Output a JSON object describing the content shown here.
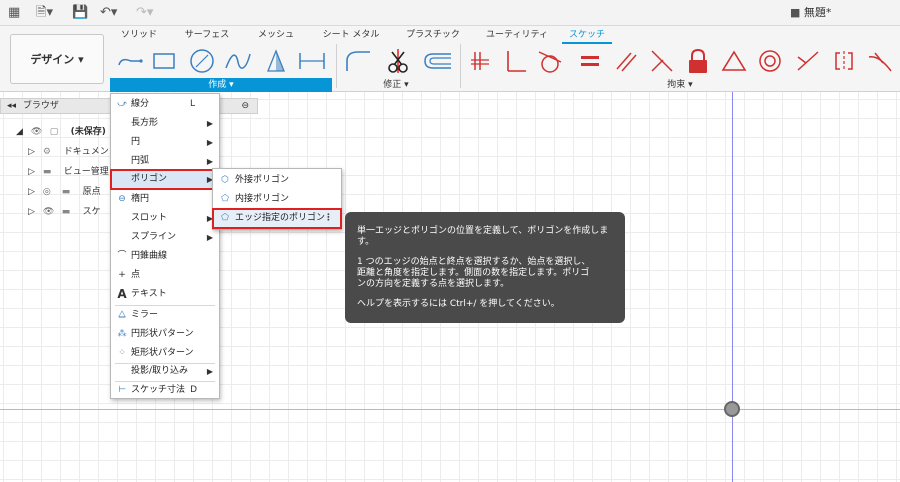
{
  "titlebar": {
    "doc_title": "無題*"
  },
  "ribbon": {
    "design_label": "デザイン ▾",
    "tabs": [
      "ソリッド",
      "サーフェス",
      "メッシュ",
      "シート メタル",
      "プラスチック",
      "ユーティリティ",
      "スケッチ"
    ],
    "active_tab": "スケッチ",
    "group_create": "作成 ▾",
    "group_modify": "修正 ▾",
    "group_constraints": "拘束 ▾"
  },
  "browser": {
    "header": "ブラウザ",
    "items": [
      {
        "label": "(未保存)"
      },
      {
        "label": "ドキュメン"
      },
      {
        "label": "ビュー管理"
      },
      {
        "label": "原点"
      },
      {
        "label": "スケ"
      }
    ]
  },
  "create_menu": {
    "items": [
      {
        "label": "線分",
        "shortcut": "L"
      },
      {
        "label": "長方形"
      },
      {
        "label": "円"
      },
      {
        "label": "円弧"
      },
      {
        "label": "ポリゴン"
      },
      {
        "label": "楕円"
      },
      {
        "label": "スロット"
      },
      {
        "label": "スプライン"
      },
      {
        "label": "円錐曲線"
      },
      {
        "label": "点"
      },
      {
        "label": "テキスト"
      },
      {
        "label": "ミラー"
      },
      {
        "label": "円形状パターン"
      },
      {
        "label": "矩形状パターン"
      },
      {
        "label": "投影/取り込み"
      },
      {
        "label": "スケッチ寸法",
        "shortcut": "D"
      }
    ]
  },
  "polygon_menu": {
    "items": [
      {
        "label": "外接ポリゴン"
      },
      {
        "label": "内接ポリゴン"
      },
      {
        "label": "エッジ指定のポリゴン"
      }
    ]
  },
  "tooltip": {
    "line1": "単一エッジとポリゴンの位置を定義して、ポリゴンを作成しま\nす。",
    "line2": "1 つのエッジの始点と終点を選択するか、始点を選択し、\n距離と角度を指定します。側面の数を指定します。ポリゴ\nンの方向を定義する点を選択します。",
    "line3": "ヘルプを表示するには  Ctrl+/ を押してください。"
  },
  "colors": {
    "accent": "#0696d7",
    "highlight_outline": "#e02020",
    "tooltip_bg": "#4a4a4a"
  }
}
